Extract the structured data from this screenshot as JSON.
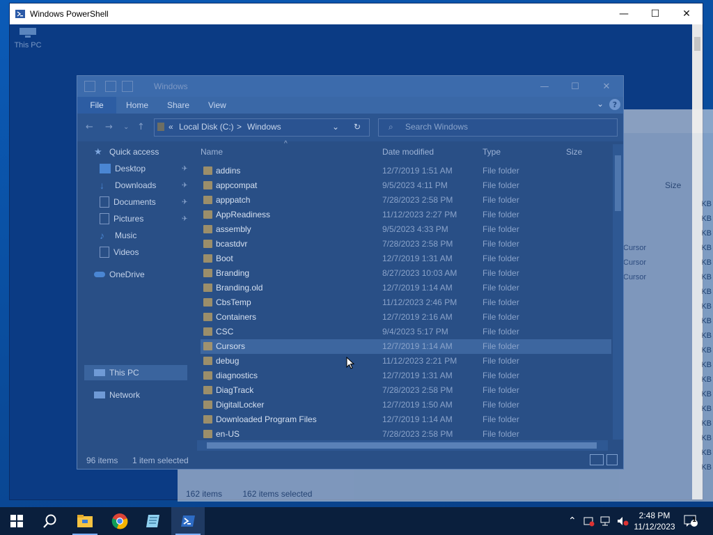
{
  "powershell": {
    "title": "Windows PowerShell",
    "minimize": "—",
    "maximize": "☐",
    "close": "✕"
  },
  "desktop": {
    "thispc": "This PC"
  },
  "back_window": {
    "size_header": "Size",
    "kb_label": "KB",
    "cursor_label": "Cursor",
    "status_items": "162 items",
    "status_selected": "162 items selected"
  },
  "explorer": {
    "title": "Windows",
    "ribbon": {
      "file": "File",
      "home": "Home",
      "share": "Share",
      "view": "View"
    },
    "address": {
      "part1": "Local Disk (C:)",
      "sep": ">",
      "part2": "Windows",
      "search_placeholder": "Search Windows"
    },
    "nav": [
      {
        "label": "Quick access",
        "icon": "star-icon"
      },
      {
        "label": "Desktop",
        "icon": "desktop-folder-icon",
        "pinned": true
      },
      {
        "label": "Downloads",
        "icon": "download-folder-icon",
        "pinned": true
      },
      {
        "label": "Documents",
        "icon": "documents-folder-icon",
        "pinned": true
      },
      {
        "label": "Pictures",
        "icon": "pictures-folder-icon",
        "pinned": true
      },
      {
        "label": "Music",
        "icon": "music-icon"
      },
      {
        "label": "Videos",
        "icon": "videos-icon"
      },
      {
        "label": "OneDrive",
        "icon": "onedrive-icon"
      },
      {
        "label": "This PC",
        "icon": "computer-icon",
        "selected": true
      },
      {
        "label": "Network",
        "icon": "network-icon"
      }
    ],
    "columns": {
      "name": "Name",
      "date": "Date modified",
      "type": "Type",
      "size": "Size"
    },
    "files": [
      {
        "name": "addins",
        "date": "12/7/2019 1:51 AM",
        "type": "File folder"
      },
      {
        "name": "appcompat",
        "date": "9/5/2023 4:11 PM",
        "type": "File folder"
      },
      {
        "name": "apppatch",
        "date": "7/28/2023 2:58 PM",
        "type": "File folder"
      },
      {
        "name": "AppReadiness",
        "date": "11/12/2023 2:27 PM",
        "type": "File folder"
      },
      {
        "name": "assembly",
        "date": "9/5/2023 4:33 PM",
        "type": "File folder"
      },
      {
        "name": "bcastdvr",
        "date": "7/28/2023 2:58 PM",
        "type": "File folder"
      },
      {
        "name": "Boot",
        "date": "12/7/2019 1:31 AM",
        "type": "File folder"
      },
      {
        "name": "Branding",
        "date": "8/27/2023 10:03 AM",
        "type": "File folder"
      },
      {
        "name": "Branding.old",
        "date": "12/7/2019 1:14 AM",
        "type": "File folder"
      },
      {
        "name": "CbsTemp",
        "date": "11/12/2023 2:46 PM",
        "type": "File folder"
      },
      {
        "name": "Containers",
        "date": "12/7/2019 2:16 AM",
        "type": "File folder"
      },
      {
        "name": "CSC",
        "date": "9/4/2023 5:17 PM",
        "type": "File folder"
      },
      {
        "name": "Cursors",
        "date": "12/7/2019 1:14 AM",
        "type": "File folder",
        "selected": true
      },
      {
        "name": "debug",
        "date": "11/12/2023 2:21 PM",
        "type": "File folder"
      },
      {
        "name": "diagnostics",
        "date": "12/7/2019 1:31 AM",
        "type": "File folder"
      },
      {
        "name": "DiagTrack",
        "date": "7/28/2023 2:58 PM",
        "type": "File folder"
      },
      {
        "name": "DigitalLocker",
        "date": "12/7/2019 1:50 AM",
        "type": "File folder"
      },
      {
        "name": "Downloaded Program Files",
        "date": "12/7/2019 1:14 AM",
        "type": "File folder"
      },
      {
        "name": "en-US",
        "date": "7/28/2023 2:58 PM",
        "type": "File folder"
      }
    ],
    "status": {
      "count": "96 items",
      "selected": "1 item selected"
    }
  },
  "taskbar": {
    "clock_time": "2:48 PM",
    "clock_date": "11/12/2023",
    "notif_count": "1"
  }
}
